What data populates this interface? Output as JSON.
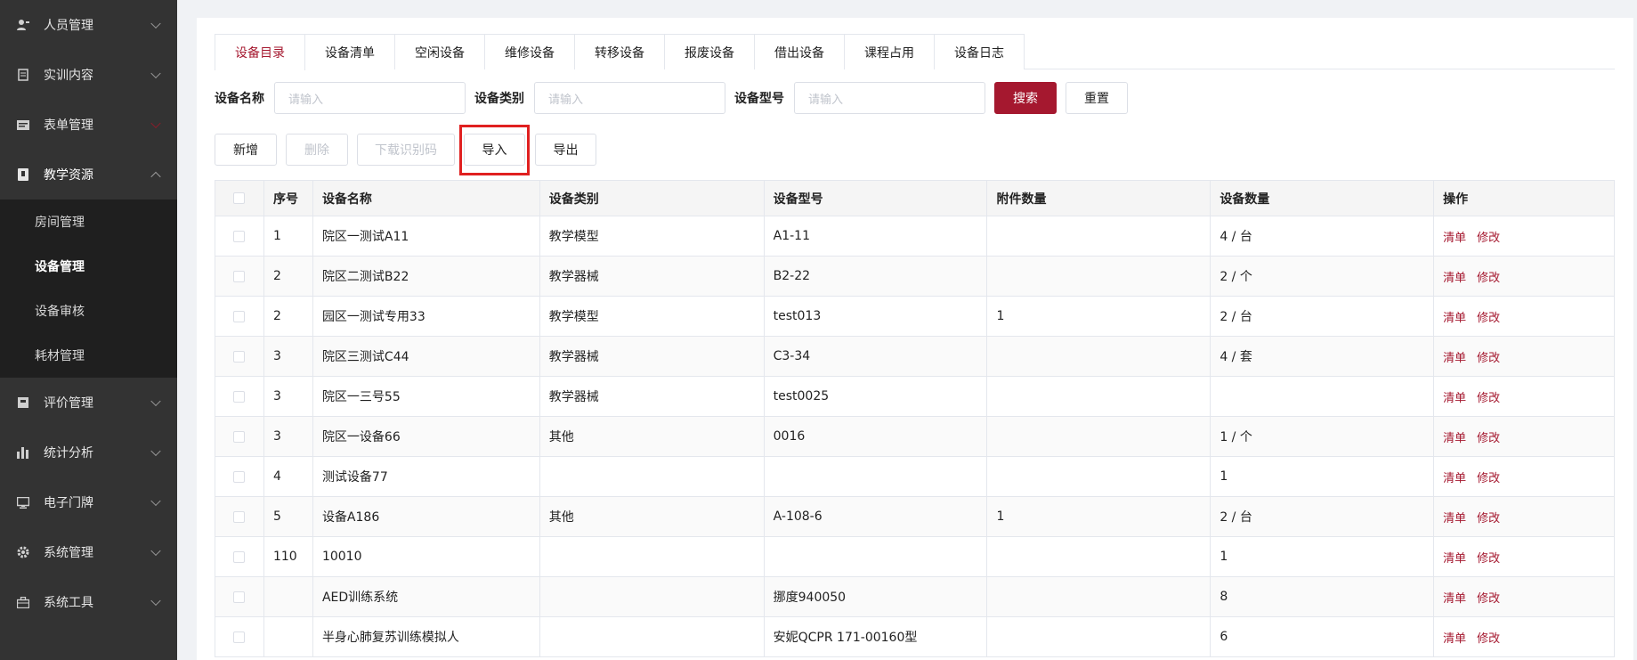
{
  "sidebar": {
    "items": [
      {
        "label": "人员管理",
        "icon": "person-icon"
      },
      {
        "label": "实训内容",
        "icon": "document-icon"
      },
      {
        "label": "表单管理",
        "icon": "form-icon"
      },
      {
        "label": "教学资源",
        "icon": "resource-icon"
      },
      {
        "label": "评价管理",
        "icon": "evaluate-icon"
      },
      {
        "label": "统计分析",
        "icon": "bar-chart-icon"
      },
      {
        "label": "电子门牌",
        "icon": "monitor-icon"
      },
      {
        "label": "系统管理",
        "icon": "gear-icon"
      },
      {
        "label": "系统工具",
        "icon": "toolbox-icon"
      }
    ],
    "submenu": [
      "房间管理",
      "设备管理",
      "设备审核",
      "耗材管理"
    ]
  },
  "tabs": [
    "设备目录",
    "设备清单",
    "空闲设备",
    "维修设备",
    "转移设备",
    "报废设备",
    "借出设备",
    "课程占用",
    "设备日志"
  ],
  "filters": {
    "name_label": "设备名称",
    "name_placeholder": "请输入",
    "type_label": "设备类别",
    "type_placeholder": "请输入",
    "model_label": "设备型号",
    "model_placeholder": "请输入",
    "search": "搜索",
    "reset": "重置"
  },
  "toolbar": {
    "add": "新增",
    "delete": "删除",
    "download": "下载识别码",
    "import": "导入",
    "export": "导出"
  },
  "table": {
    "headers": [
      "序号",
      "设备名称",
      "设备类别",
      "设备型号",
      "附件数量",
      "设备数量",
      "操作"
    ],
    "rows": [
      {
        "no": "1",
        "name": "院区一测试A11",
        "type": "教学模型",
        "model": "A1-11",
        "attach": "",
        "qty": "4 / 台"
      },
      {
        "no": "2",
        "name": "院区二测试B22",
        "type": "教学器械",
        "model": "B2-22",
        "attach": "",
        "qty": "2 / 个"
      },
      {
        "no": "2",
        "name": "园区一测试专用33",
        "type": "教学模型",
        "model": "test013",
        "attach": "1",
        "qty": "2 / 台"
      },
      {
        "no": "3",
        "name": "院区三测试C44",
        "type": "教学器械",
        "model": "C3-34",
        "attach": "",
        "qty": "4 / 套"
      },
      {
        "no": "3",
        "name": "院区一三号55",
        "type": "教学器械",
        "model": "test0025",
        "attach": "",
        "qty": ""
      },
      {
        "no": "3",
        "name": "院区一设备66",
        "type": "其他",
        "model": "0016",
        "attach": "",
        "qty": "1 / 个"
      },
      {
        "no": "4",
        "name": "测试设备77",
        "type": "",
        "model": "",
        "attach": "",
        "qty": "1"
      },
      {
        "no": "5",
        "name": "设备A186",
        "type": "其他",
        "model": "A-108-6",
        "attach": "1",
        "qty": "2 / 台"
      },
      {
        "no": "110",
        "name": "10010",
        "type": "",
        "model": "",
        "attach": "",
        "qty": "1"
      },
      {
        "no": "",
        "name": "AED训练系统",
        "type": "",
        "model": "挪度940050",
        "attach": "",
        "qty": "8"
      },
      {
        "no": "",
        "name": "半身心肺复苏训练模拟人",
        "type": "",
        "model": "安妮QCPR 171-00160型",
        "attach": "",
        "qty": "6"
      }
    ],
    "op_list": "清单",
    "op_edit": "修改"
  }
}
